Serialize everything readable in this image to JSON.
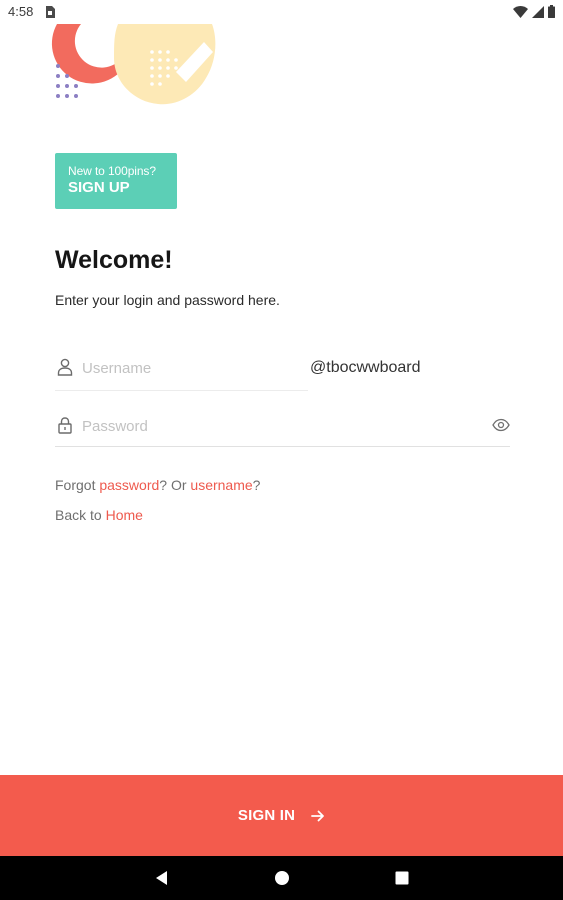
{
  "status_bar": {
    "time": "4:58",
    "icons": [
      "sim-card-icon",
      "wifi-icon",
      "signal-icon",
      "battery-icon"
    ]
  },
  "signup": {
    "prompt": "New to 100pins?",
    "label": "SIGN UP"
  },
  "welcome": {
    "title": "Welcome!",
    "subtitle": "Enter your login and password here."
  },
  "form": {
    "username": {
      "placeholder": "Username",
      "value": "",
      "suffix": "@tbocwwboard",
      "icon": "user-icon"
    },
    "password": {
      "placeholder": "Password",
      "value": "",
      "icon": "lock-icon",
      "toggle_icon": "eye-icon"
    }
  },
  "links": {
    "forgot_prefix": "Forgot ",
    "password_link": "password",
    "or_text": "? Or ",
    "username_link": "username",
    "forgot_suffix": "?",
    "back_prefix": "Back to ",
    "home_link": "Home"
  },
  "signin": {
    "label": "SIGN IN",
    "icon": "arrow-right-icon"
  },
  "nav": {
    "buttons": [
      "back-icon",
      "home-icon",
      "recents-icon"
    ]
  },
  "colors": {
    "accent": "#f35b4d",
    "teal": "#5ccfb6",
    "link": "#ee5a4e",
    "coral_decoration": "#f26b5e",
    "yellow_decoration": "#fde9b6",
    "dots_purple": "#8c7fc3"
  }
}
